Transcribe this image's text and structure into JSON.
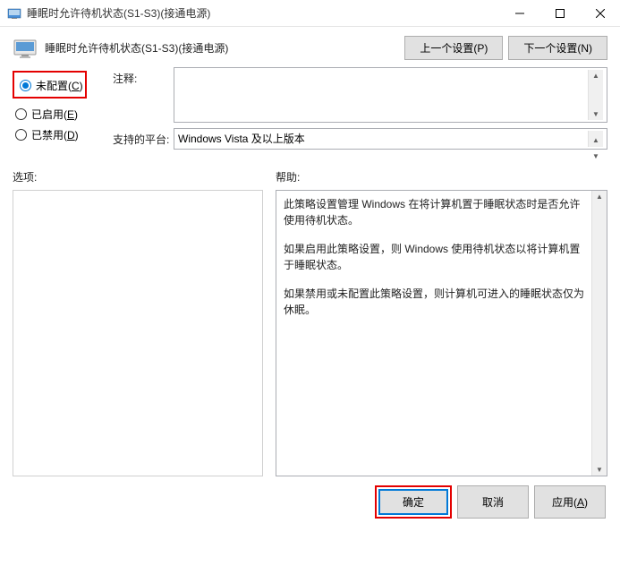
{
  "titlebar": {
    "title": "睡眠时允许待机状态(S1-S3)(接通电源)"
  },
  "header": {
    "title": "睡眠时允许待机状态(S1-S3)(接通电源)",
    "prev_button": "上一个设置(P)",
    "next_button": "下一个设置(N)"
  },
  "radios": {
    "not_configured": "未配置(C)",
    "enabled": "已启用(E)",
    "disabled": "已禁用(D)"
  },
  "form": {
    "comment_label": "注释:",
    "comment_value": "",
    "platform_label": "支持的平台:",
    "platform_value": "Windows Vista 及以上版本"
  },
  "sections": {
    "options_label": "选项:",
    "help_label": "帮助:"
  },
  "help": {
    "p1": "此策略设置管理 Windows 在将计算机置于睡眠状态时是否允许使用待机状态。",
    "p2": "如果启用此策略设置，则 Windows 使用待机状态以将计算机置于睡眠状态。",
    "p3": "如果禁用或未配置此策略设置，则计算机可进入的睡眠状态仅为休眠。"
  },
  "footer": {
    "ok": "确定",
    "cancel": "取消",
    "apply": "应用(A)"
  }
}
